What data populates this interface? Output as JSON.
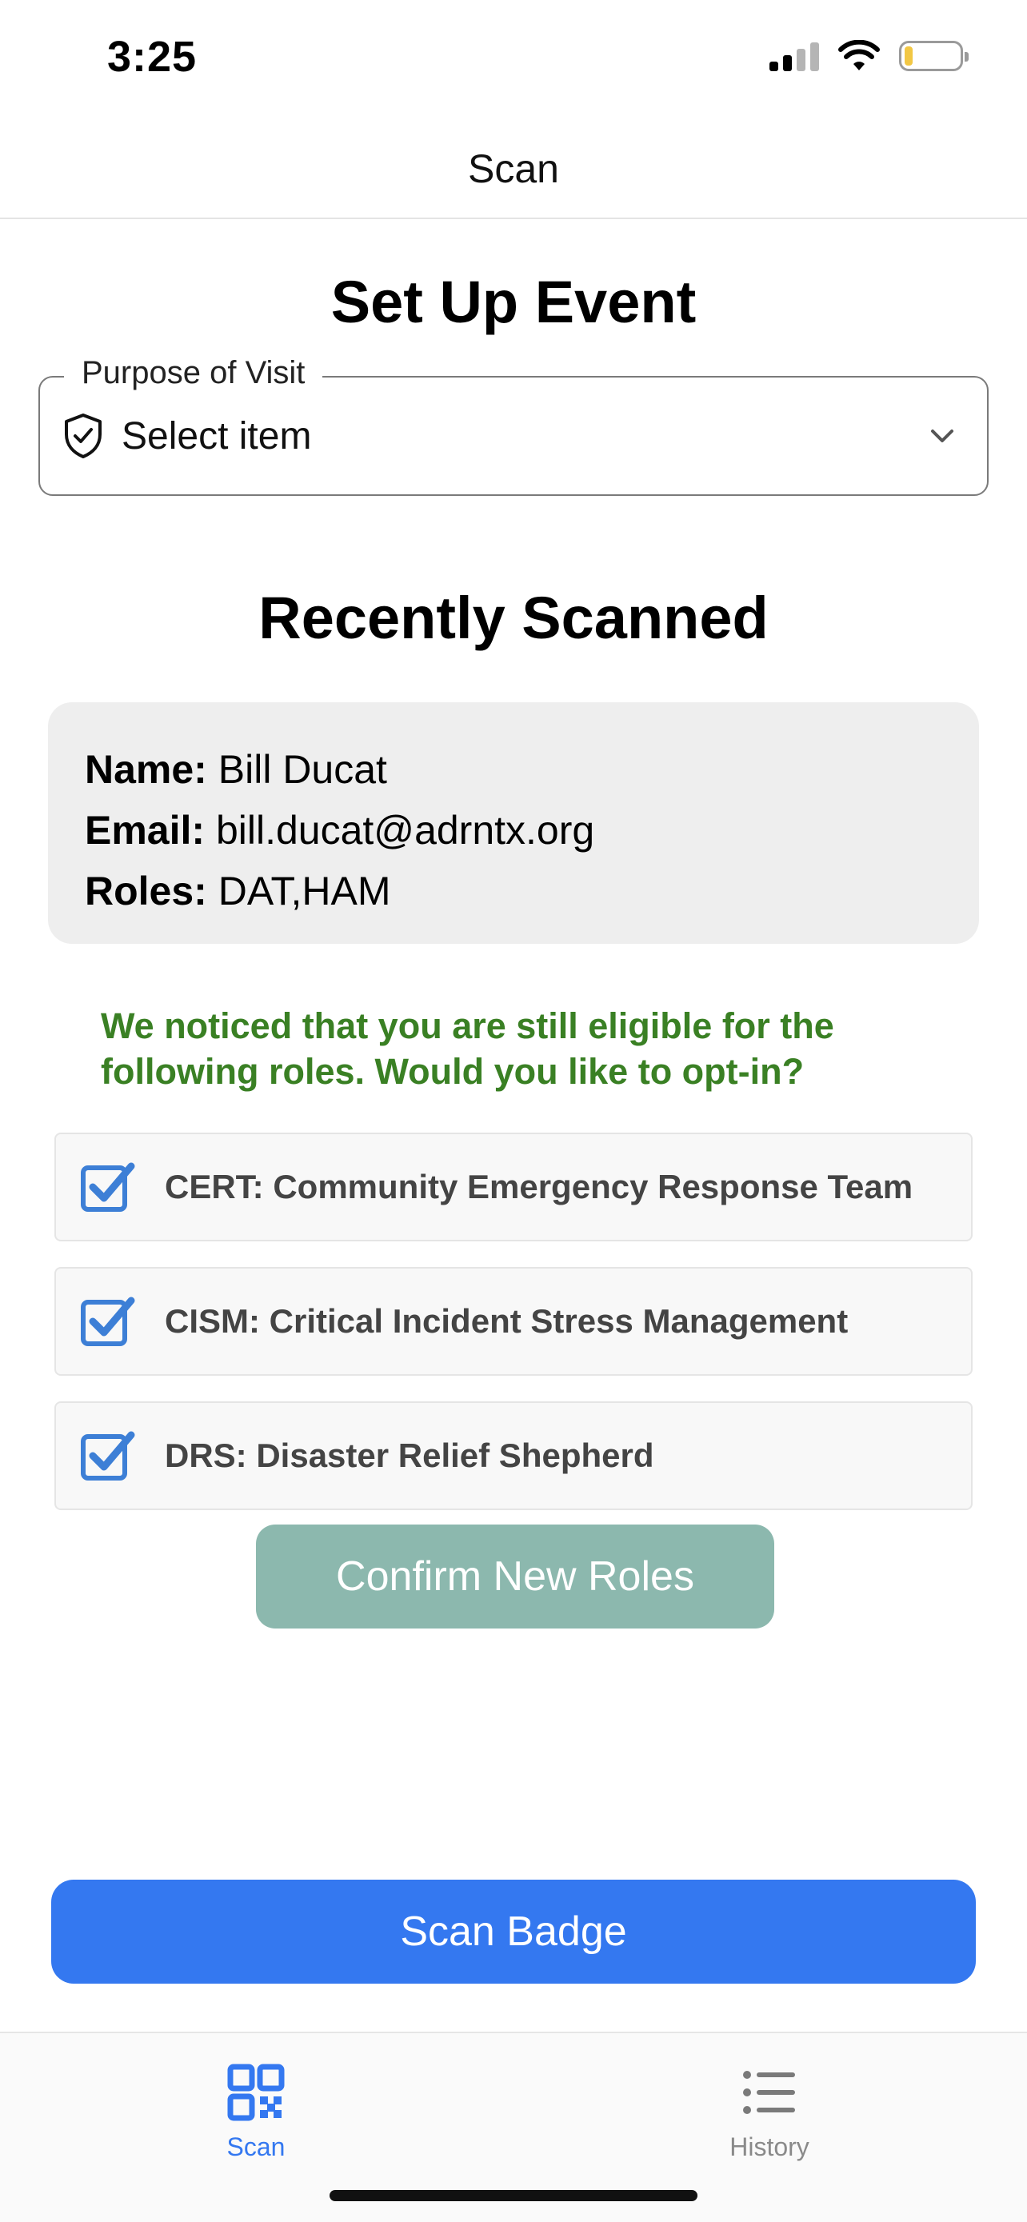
{
  "status_bar": {
    "time": "3:25",
    "signal_icon": "cellular-signal-icon",
    "wifi_icon": "wifi-icon",
    "battery_icon": "battery-icon",
    "battery_level": 0.15,
    "battery_color": "#f2c744"
  },
  "header": {
    "title": "Scan"
  },
  "setup": {
    "title": "Set Up Event",
    "purpose_label": "Purpose of Visit",
    "select_value": "Select item",
    "select_icon": "shield-check-icon",
    "dropdown_icon": "chevron-down-icon"
  },
  "recent": {
    "title": "Recently Scanned",
    "name_label": "Name:",
    "name_value": "Bill Ducat",
    "email_label": "Email:",
    "email_value": "bill.ducat@adrntx.org",
    "roles_label": "Roles:",
    "roles_value": "DAT,HAM"
  },
  "notice": {
    "text": "We noticed that you are still eligible for the following roles. Would you like to opt-in?",
    "color": "#3a8024"
  },
  "roles": [
    {
      "label": "CERT: Community Emergency Response Team",
      "checked": true
    },
    {
      "label": "CISM: Critical Incident Stress Management",
      "checked": true
    },
    {
      "label": "DRS: Disaster Relief Shepherd",
      "checked": true
    }
  ],
  "confirm_button": {
    "label": "Confirm New Roles",
    "color": "#8cb8ae"
  },
  "scan_button": {
    "label": "Scan Badge",
    "color": "#3478f0"
  },
  "tabs": [
    {
      "label": "Scan",
      "icon": "qr-code-icon",
      "active": true
    },
    {
      "label": "History",
      "icon": "list-icon",
      "active": false
    }
  ]
}
